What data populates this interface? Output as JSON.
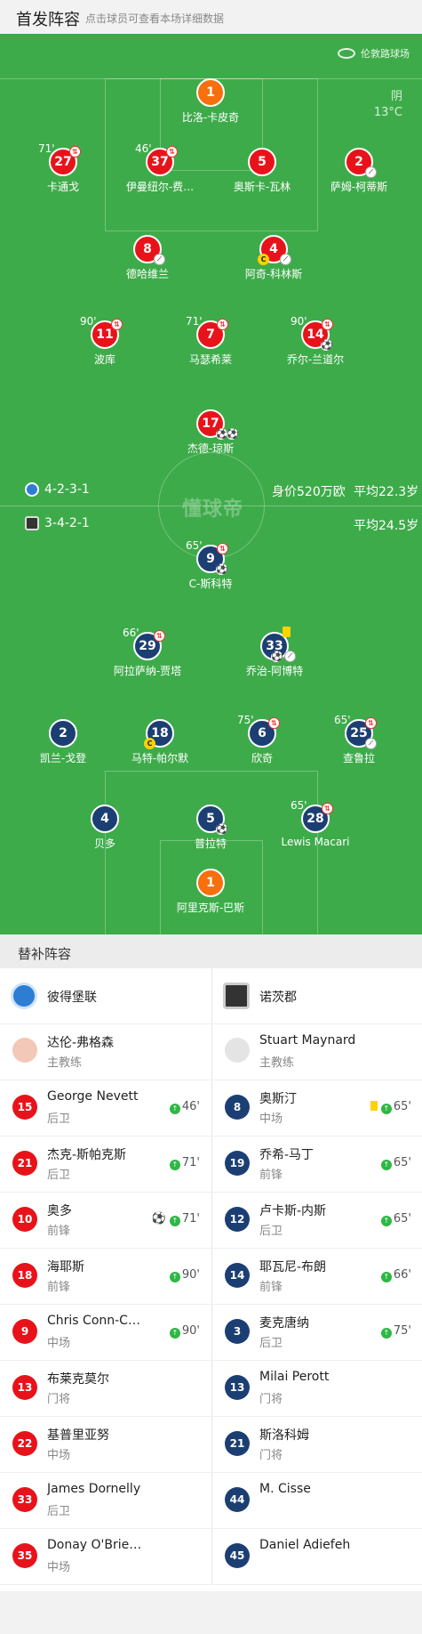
{
  "header": {
    "title": "首发阵容",
    "subtitle": "点击球员可查看本场详细数据"
  },
  "match": {
    "stadium": "伦敦路球场",
    "weather": "阴",
    "temperature": "13°C",
    "watermark": "懂球帝"
  },
  "home": {
    "name": "彼得堡联",
    "formation": "4-2-3-1",
    "value": "身价520万欧",
    "avg_age": "平均22.3岁",
    "color": "#e8131a",
    "players": [
      {
        "num": "1",
        "name": "比洛-卡皮奇"
      },
      {
        "num": "27",
        "name": "卡通戈",
        "sub": "71'"
      },
      {
        "num": "37",
        "name": "伊曼纽尔-费…",
        "sub": "46'"
      },
      {
        "num": "5",
        "name": "奥斯卡-瓦林"
      },
      {
        "num": "2",
        "name": "萨姆-柯蒂斯"
      },
      {
        "num": "8",
        "name": "德哈维兰"
      },
      {
        "num": "4",
        "name": "阿奇-科林斯"
      },
      {
        "num": "11",
        "name": "波库",
        "sub": "90'"
      },
      {
        "num": "7",
        "name": "马瑟希莱",
        "sub": "71'"
      },
      {
        "num": "14",
        "name": "乔尔-兰道尔",
        "sub": "90'"
      },
      {
        "num": "17",
        "name": "杰德-琼斯"
      }
    ]
  },
  "away": {
    "name": "诺茨郡",
    "formation": "3-4-2-1",
    "avg_age": "平均24.5岁",
    "color": "#1c3f73",
    "players": [
      {
        "num": "9",
        "name": "C-斯科特",
        "sub": "65'"
      },
      {
        "num": "29",
        "name": "阿拉萨纳-贾塔",
        "sub": "66'"
      },
      {
        "num": "33",
        "name": "乔治-阿博特"
      },
      {
        "num": "2",
        "name": "凯兰-戈登"
      },
      {
        "num": "18",
        "name": "马特-帕尔默"
      },
      {
        "num": "6",
        "name": "欣奇",
        "sub": "75'"
      },
      {
        "num": "25",
        "name": "查鲁拉",
        "sub": "65'"
      },
      {
        "num": "4",
        "name": "贝多"
      },
      {
        "num": "5",
        "name": "普拉特"
      },
      {
        "num": "28",
        "name": "Lewis Macari",
        "sub": "65'"
      },
      {
        "num": "1",
        "name": "阿里克斯-巴斯"
      }
    ]
  },
  "subs": {
    "title": "替补阵容",
    "coach_label": "主教练",
    "home": {
      "coach": "达伦-弗格森",
      "players": [
        {
          "num": "15",
          "name": "George Nevett",
          "pos": "后卫",
          "time": "46'"
        },
        {
          "num": "21",
          "name": "杰克-斯帕克斯",
          "pos": "后卫",
          "time": "71'"
        },
        {
          "num": "10",
          "name": "奥多",
          "pos": "前锋",
          "time": "71'"
        },
        {
          "num": "18",
          "name": "海耶斯",
          "pos": "前锋",
          "time": "90'"
        },
        {
          "num": "9",
          "name": "Chris Conn-C…",
          "pos": "中场",
          "time": "90'"
        },
        {
          "num": "13",
          "name": "布莱克莫尔",
          "pos": "门将"
        },
        {
          "num": "22",
          "name": "基普里亚努",
          "pos": "中场"
        },
        {
          "num": "33",
          "name": "James Dornelly",
          "pos": "后卫"
        },
        {
          "num": "35",
          "name": "Donay O'Brie…",
          "pos": "中场"
        }
      ]
    },
    "away": {
      "coach": "Stuart Maynard",
      "players": [
        {
          "num": "8",
          "name": "奥斯汀",
          "pos": "中场",
          "time": "65'"
        },
        {
          "num": "19",
          "name": "乔希-马丁",
          "pos": "前锋",
          "time": "65'"
        },
        {
          "num": "12",
          "name": "卢卡斯-内斯",
          "pos": "后卫",
          "time": "65'"
        },
        {
          "num": "14",
          "name": "耶瓦尼-布朗",
          "pos": "前锋",
          "time": "66'"
        },
        {
          "num": "3",
          "name": "麦克唐纳",
          "pos": "后卫",
          "time": "75'"
        },
        {
          "num": "13",
          "name": "Milai Perott",
          "pos": "门将"
        },
        {
          "num": "21",
          "name": "斯洛科姆",
          "pos": "门将"
        },
        {
          "num": "44",
          "name": "M. Cisse",
          "pos": ""
        },
        {
          "num": "45",
          "name": "Daniel Adiefeh",
          "pos": ""
        }
      ]
    }
  },
  "icons": {
    "sub_out": "sub-out-icon",
    "sub_in": "sub-in-arrow-icon",
    "goal": "football-icon",
    "captain": "captain-badge-icon",
    "yellow": "yellow-card-icon"
  }
}
